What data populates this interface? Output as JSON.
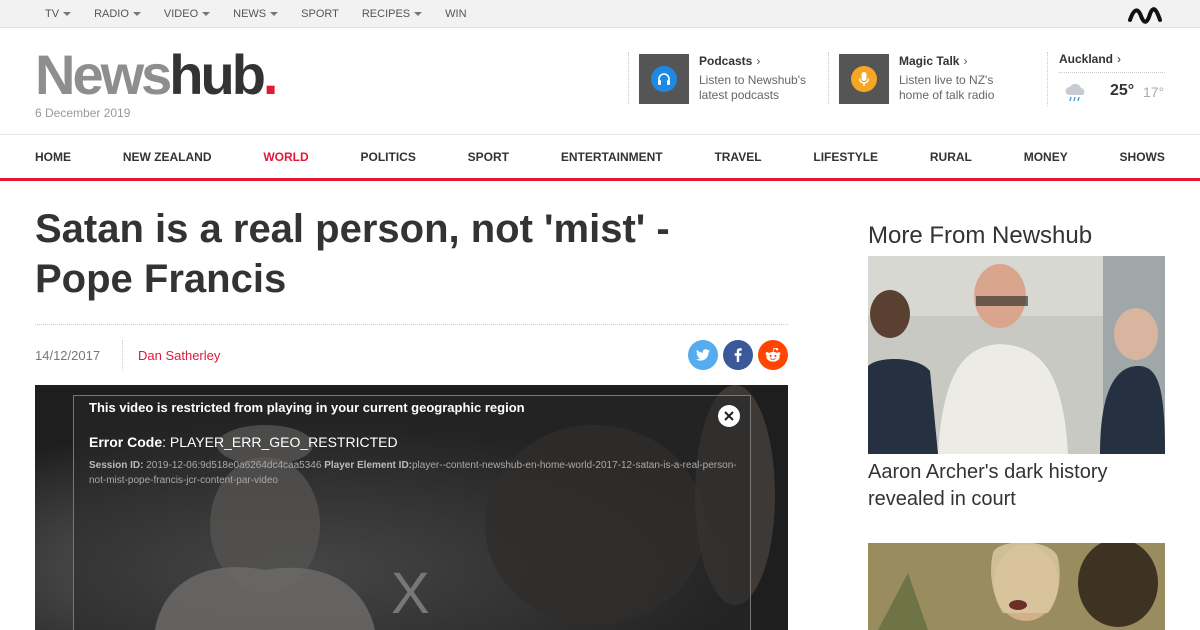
{
  "topbar": {
    "menu": [
      {
        "label": "TV",
        "has_caret": true
      },
      {
        "label": "RADIO",
        "has_caret": true
      },
      {
        "label": "VIDEO",
        "has_caret": true
      },
      {
        "label": "NEWS",
        "has_caret": true
      },
      {
        "label": "SPORT",
        "has_caret": false
      },
      {
        "label": "RECIPES",
        "has_caret": true
      },
      {
        "label": "WIN",
        "has_caret": false
      }
    ],
    "brand_icon": "mediaworks-wave-icon"
  },
  "header": {
    "logo": {
      "part1": "News",
      "part2": "hub",
      "dot": "."
    },
    "date": "6 December 2019",
    "podcasts": {
      "title": "Podcasts",
      "desc": "Listen to Newshub's latest podcasts",
      "icon": "headphones-icon"
    },
    "magic_talk": {
      "title": "Magic Talk",
      "desc": "Listen live to NZ's home of talk radio",
      "icon": "microphone-icon"
    },
    "weather": {
      "city": "Auckland",
      "high": "25°",
      "low": "17°",
      "icon": "rain-cloud-icon"
    }
  },
  "nav": {
    "items": [
      {
        "label": "HOME"
      },
      {
        "label": "NEW ZEALAND"
      },
      {
        "label": "WORLD",
        "active": true
      },
      {
        "label": "POLITICS"
      },
      {
        "label": "SPORT"
      },
      {
        "label": "ENTERTAINMENT"
      },
      {
        "label": "TRAVEL"
      },
      {
        "label": "LIFESTYLE"
      },
      {
        "label": "RURAL"
      },
      {
        "label": "MONEY"
      },
      {
        "label": "SHOWS"
      }
    ]
  },
  "article": {
    "headline": "Satan is a real person, not 'mist' - Pope Francis",
    "date": "14/12/2017",
    "author": "Dan Satherley",
    "share": [
      "twitter-icon",
      "facebook-icon",
      "reddit-icon"
    ]
  },
  "video": {
    "error_title": "This video is restricted from playing in your current geographic region",
    "error_code_label": "Error Code",
    "error_code_value": ": PLAYER_ERR_GEO_RESTRICTED",
    "session_label": "Session ID:",
    "session_value": " 2019-12-06:9d518e0a6264dc4caa5346 ",
    "element_label": "Player Element ID:",
    "element_value": "player--content-newshub-en-home-world-2017-12-satan-is-a-real-person-not-mist-pope-francis-jcr-content-par-video",
    "big_x": "X"
  },
  "sidebar": {
    "title": "More From Newshub",
    "cards": [
      {
        "headline": "Aaron Archer's dark history revealed in court"
      },
      {
        "headline": ""
      }
    ]
  },
  "colors": {
    "accent": "#e31837",
    "twitter": "#55acee",
    "facebook": "#3b5998",
    "reddit": "#ff4500",
    "podcast_circle": "#1e88e5",
    "mic_circle": "#f5a623"
  }
}
